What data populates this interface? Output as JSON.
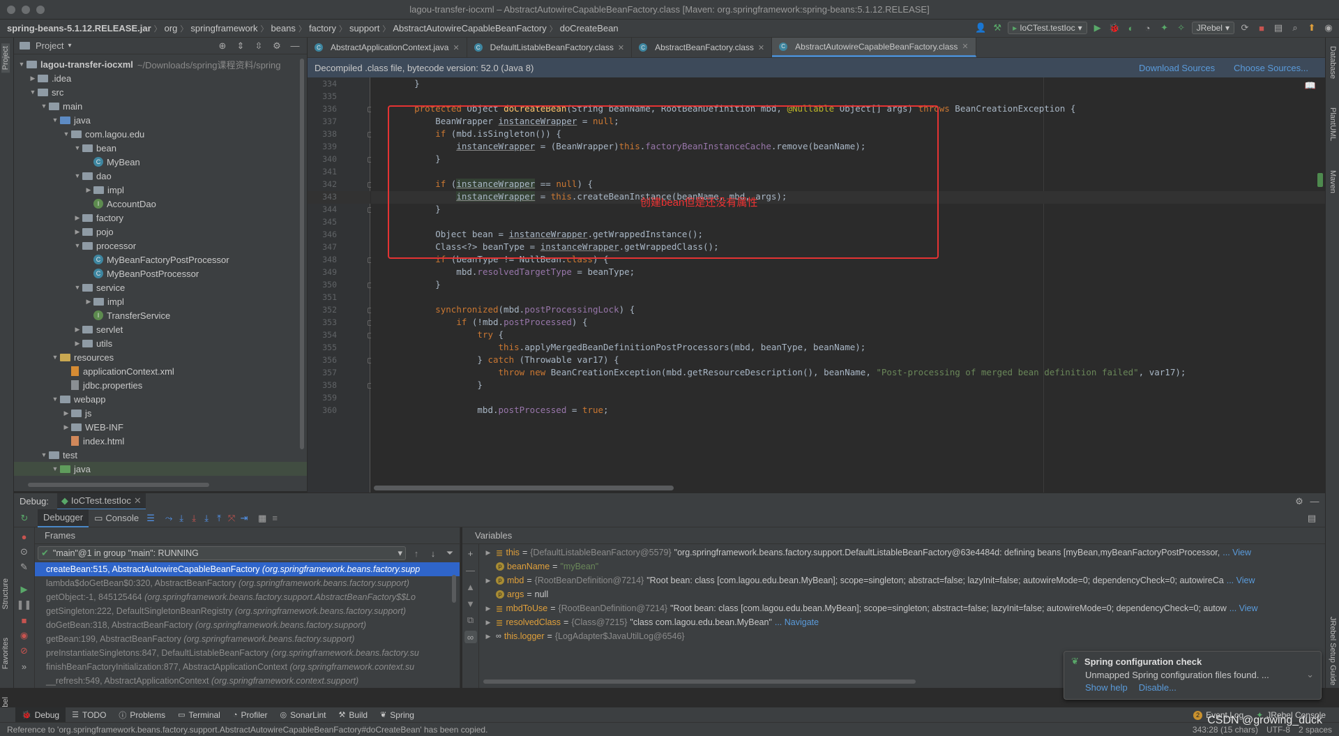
{
  "window": {
    "title": "lagou-transfer-iocxml – AbstractAutowireCapableBeanFactory.class [Maven: org.springframework:spring-beans:5.1.12.RELEASE]"
  },
  "breadcrumb": [
    "spring-beans-5.1.12.RELEASE.jar",
    "org",
    "springframework",
    "beans",
    "factory",
    "support",
    "AbstractAutowireCapableBeanFactory",
    "doCreateBean"
  ],
  "toolbar": {
    "run_config": "IoCTest.testIoc",
    "jrebel": "JRebel"
  },
  "left_strip": [
    "Project",
    "Structure",
    "Favorites",
    "JRebel"
  ],
  "right_strip": [
    "Database",
    "PlantUML",
    "Maven",
    "JRebel Setup Guide"
  ],
  "project": {
    "header": "Project",
    "root": "lagou-transfer-iocxml",
    "root_path": "~/Downloads/spring课程资料/spring",
    "items": [
      {
        "label": "lagou-transfer-iocxml",
        "depth": 0,
        "kind": "root",
        "arrow": "▼"
      },
      {
        "label": ".idea",
        "depth": 1,
        "kind": "folder",
        "arrow": "▶"
      },
      {
        "label": "src",
        "depth": 1,
        "kind": "folder",
        "arrow": "▼"
      },
      {
        "label": "main",
        "depth": 2,
        "kind": "folder",
        "arrow": "▼"
      },
      {
        "label": "java",
        "depth": 3,
        "kind": "src",
        "arrow": "▼"
      },
      {
        "label": "com.lagou.edu",
        "depth": 4,
        "kind": "pkg",
        "arrow": "▼"
      },
      {
        "label": "bean",
        "depth": 5,
        "kind": "pkg",
        "arrow": "▼"
      },
      {
        "label": "MyBean",
        "depth": 6,
        "kind": "class",
        "arrow": ""
      },
      {
        "label": "dao",
        "depth": 5,
        "kind": "pkg",
        "arrow": "▼"
      },
      {
        "label": "impl",
        "depth": 6,
        "kind": "pkg",
        "arrow": "▶"
      },
      {
        "label": "AccountDao",
        "depth": 6,
        "kind": "intf",
        "arrow": ""
      },
      {
        "label": "factory",
        "depth": 5,
        "kind": "pkg",
        "arrow": "▶"
      },
      {
        "label": "pojo",
        "depth": 5,
        "kind": "pkg",
        "arrow": "▶"
      },
      {
        "label": "processor",
        "depth": 5,
        "kind": "pkg",
        "arrow": "▼"
      },
      {
        "label": "MyBeanFactoryPostProcessor",
        "depth": 6,
        "kind": "class",
        "arrow": ""
      },
      {
        "label": "MyBeanPostProcessor",
        "depth": 6,
        "kind": "class",
        "arrow": ""
      },
      {
        "label": "service",
        "depth": 5,
        "kind": "pkg",
        "arrow": "▼"
      },
      {
        "label": "impl",
        "depth": 6,
        "kind": "pkg",
        "arrow": "▶"
      },
      {
        "label": "TransferService",
        "depth": 6,
        "kind": "intf",
        "arrow": ""
      },
      {
        "label": "servlet",
        "depth": 5,
        "kind": "pkg",
        "arrow": "▶"
      },
      {
        "label": "utils",
        "depth": 5,
        "kind": "pkg",
        "arrow": "▶"
      },
      {
        "label": "resources",
        "depth": 3,
        "kind": "res",
        "arrow": "▼"
      },
      {
        "label": "applicationContext.xml",
        "depth": 4,
        "kind": "xml",
        "arrow": ""
      },
      {
        "label": "jdbc.properties",
        "depth": 4,
        "kind": "prop",
        "arrow": ""
      },
      {
        "label": "webapp",
        "depth": 3,
        "kind": "folder",
        "arrow": "▼"
      },
      {
        "label": "js",
        "depth": 4,
        "kind": "folder",
        "arrow": "▶"
      },
      {
        "label": "WEB-INF",
        "depth": 4,
        "kind": "folder",
        "arrow": "▶"
      },
      {
        "label": "index.html",
        "depth": 4,
        "kind": "html",
        "arrow": ""
      },
      {
        "label": "test",
        "depth": 2,
        "kind": "folder",
        "arrow": "▼"
      },
      {
        "label": "java",
        "depth": 3,
        "kind": "test",
        "arrow": "▼"
      }
    ]
  },
  "editor_tabs": [
    {
      "label": "AbstractApplicationContext.java",
      "active": false
    },
    {
      "label": "DefaultListableBeanFactory.class",
      "active": false
    },
    {
      "label": "AbstractBeanFactory.class",
      "active": false
    },
    {
      "label": "AbstractAutowireCapableBeanFactory.class",
      "active": true
    }
  ],
  "decompiled_banner": {
    "text": "Decompiled .class file, bytecode version: 52.0 (Java 8)",
    "download": "Download Sources",
    "choose": "Choose Sources..."
  },
  "code": {
    "current_line": 343,
    "annotation": "创建bean但是还没有属性",
    "lines": [
      {
        "n": 334,
        "html": "    }"
      },
      {
        "n": 335,
        "html": ""
      },
      {
        "n": 336,
        "html": "    <span class=\"k\">protected</span> Object <span class=\"fn\">doCreateBean</span>(String beanName, RootBeanDefinition mbd, <span class=\"ann\">@Nullable</span> Object[] args) <span class=\"k\">throws</span> BeanCreationException {"
      },
      {
        "n": 337,
        "html": "        BeanWrapper <span class=\"u\">instanceWrapper</span> = <span class=\"k\">null</span>;"
      },
      {
        "n": 338,
        "html": "        <span class=\"k\">if</span> (mbd.isSingleton()) {"
      },
      {
        "n": 339,
        "html": "            <span class=\"u\">instanceWrapper</span> = (BeanWrapper)<span class=\"k\">this</span>.<span class=\"fld\">factoryBeanInstanceCache</span>.remove(beanName);"
      },
      {
        "n": 340,
        "html": "        }"
      },
      {
        "n": 341,
        "html": ""
      },
      {
        "n": 342,
        "html": "        <span class=\"k\">if</span> (<span class=\"u hl\">instanceWrapper</span> == <span class=\"k\">null</span>) {"
      },
      {
        "n": 343,
        "html": "            <span class=\"u hl\">instanceWrapper</span> = <span class=\"k\">this</span>.createBeanInstance(beanName, mbd, args);"
      },
      {
        "n": 344,
        "html": "        }"
      },
      {
        "n": 345,
        "html": ""
      },
      {
        "n": 346,
        "html": "        Object bean = <span class=\"u\">instanceWrapper</span>.getWrappedInstance();"
      },
      {
        "n": 347,
        "html": "        Class&lt;?&gt; beanType = <span class=\"u\">instanceWrapper</span>.getWrappedClass();"
      },
      {
        "n": 348,
        "html": "        <span class=\"k\">if</span> (beanType != NullBean.<span class=\"k\">class</span>) {"
      },
      {
        "n": 349,
        "html": "            mbd.<span class=\"fld\">resolvedTargetType</span> = beanType;"
      },
      {
        "n": 350,
        "html": "        }"
      },
      {
        "n": 351,
        "html": ""
      },
      {
        "n": 352,
        "html": "        <span class=\"k\">synchronized</span>(mbd.<span class=\"fld\">postProcessingLock</span>) {"
      },
      {
        "n": 353,
        "html": "            <span class=\"k\">if</span> (!mbd.<span class=\"fld\">postProcessed</span>) {"
      },
      {
        "n": 354,
        "html": "                <span class=\"k\">try</span> {"
      },
      {
        "n": 355,
        "html": "                    <span class=\"k\">this</span>.applyMergedBeanDefinitionPostProcessors(mbd, beanType, beanName);"
      },
      {
        "n": 356,
        "html": "                } <span class=\"k\">catch</span> (Throwable var17) {"
      },
      {
        "n": 357,
        "html": "                    <span class=\"k\">throw new</span> BeanCreationException(mbd.getResourceDescription(), beanName, <span class=\"str\">\"Post-processing of merged bean definition failed\"</span>, var17);"
      },
      {
        "n": 358,
        "html": "                }"
      },
      {
        "n": 359,
        "html": ""
      },
      {
        "n": 360,
        "html": "                mbd.<span class=\"fld\">postProcessed</span> = <span class=\"k\">true</span>;"
      }
    ]
  },
  "debug": {
    "label": "Debug:",
    "session": "IoCTest.testIoc",
    "tab_debugger": "Debugger",
    "tab_console": "Console",
    "frames_title": "Frames",
    "variables_title": "Variables",
    "thread": "\"main\"@1 in group \"main\": RUNNING",
    "frames": [
      {
        "method": "createBean:515, AbstractAutowireCapableBeanFactory",
        "pkg": "(org.springframework.beans.factory.supp",
        "selected": true
      },
      {
        "method": "lambda$doGetBean$0:320, AbstractBeanFactory",
        "pkg": "(org.springframework.beans.factory.support)",
        "selected": false
      },
      {
        "method": "getObject:-1, 845125464",
        "pkg": "(org.springframework.beans.factory.support.AbstractBeanFactory$$Lo",
        "selected": false
      },
      {
        "method": "getSingleton:222, DefaultSingletonBeanRegistry",
        "pkg": "(org.springframework.beans.factory.support)",
        "selected": false
      },
      {
        "method": "doGetBean:318, AbstractBeanFactory",
        "pkg": "(org.springframework.beans.factory.support)",
        "selected": false
      },
      {
        "method": "getBean:199, AbstractBeanFactory",
        "pkg": "(org.springframework.beans.factory.support)",
        "selected": false
      },
      {
        "method": "preInstantiateSingletons:847, DefaultListableBeanFactory",
        "pkg": "(org.springframework.beans.factory.su",
        "selected": false
      },
      {
        "method": "finishBeanFactoryInitialization:877, AbstractApplicationContext",
        "pkg": "(org.springframework.context.su",
        "selected": false
      },
      {
        "method": "__refresh:549, AbstractApplicationContext",
        "pkg": "(org.springframework.context.support)",
        "selected": false
      }
    ],
    "variables": [
      {
        "name": "this",
        "type": "{DefaultListableBeanFactory@5579}",
        "value": "\"org.springframework.beans.factory.support.DefaultListableBeanFactory@63e4484d: defining beans [myBean,myBeanFactoryPostProcessor,",
        "view": "... View",
        "expand": true,
        "icon": "field"
      },
      {
        "name": "beanName",
        "type": "",
        "value": "\"myBean\"",
        "view": "",
        "expand": false,
        "icon": "param",
        "string": true
      },
      {
        "name": "mbd",
        "type": "{RootBeanDefinition@7214}",
        "value": "\"Root bean: class [com.lagou.edu.bean.MyBean]; scope=singleton; abstract=false; lazyInit=false; autowireMode=0; dependencyCheck=0; autowireCa",
        "view": "... View",
        "expand": true,
        "icon": "param"
      },
      {
        "name": "args",
        "type": "",
        "value": "null",
        "view": "",
        "expand": false,
        "icon": "param"
      },
      {
        "name": "mbdToUse",
        "type": "{RootBeanDefinition@7214}",
        "value": "\"Root bean: class [com.lagou.edu.bean.MyBean]; scope=singleton; abstract=false; lazyInit=false; autowireMode=0; dependencyCheck=0; autow",
        "view": "... View",
        "expand": true,
        "icon": "field"
      },
      {
        "name": "resolvedClass",
        "type": "{Class@7215}",
        "value": "\"class com.lagou.edu.bean.MyBean\"",
        "view": "... Navigate",
        "expand": true,
        "icon": "field"
      },
      {
        "name": "this.logger",
        "type": "{LogAdapter$JavaUtilLog@6546}",
        "value": "",
        "view": "",
        "expand": true,
        "icon": "oo"
      }
    ]
  },
  "popup": {
    "title": "Spring configuration check",
    "body": "Unmapped Spring configuration files found. ...",
    "help": "Show help",
    "disable": "Disable..."
  },
  "bottom_tabs": [
    {
      "label": "Debug",
      "icon": "bug",
      "active": true
    },
    {
      "label": "TODO",
      "icon": "list",
      "active": false
    },
    {
      "label": "Problems",
      "icon": "info",
      "active": false
    },
    {
      "label": "Terminal",
      "icon": "term",
      "active": false
    },
    {
      "label": "Profiler",
      "icon": "prof",
      "active": false
    },
    {
      "label": "SonarLint",
      "icon": "sonar",
      "active": false
    },
    {
      "label": "Build",
      "icon": "build",
      "active": false
    },
    {
      "label": "Spring",
      "icon": "leaf",
      "active": false
    }
  ],
  "bottom_right": {
    "event_log": "Event Log",
    "event_count": "2",
    "jrebel_console": "JRebel Console"
  },
  "status": {
    "message": "Reference to 'org.springframework.beans.factory.support.AbstractAutowireCapableBeanFactory#doCreateBean' has been copied.",
    "position": "343:28 (15 chars)",
    "encoding": "UTF-8",
    "indent": "2 spaces",
    "watermark": "CSDN @growing_duck"
  }
}
